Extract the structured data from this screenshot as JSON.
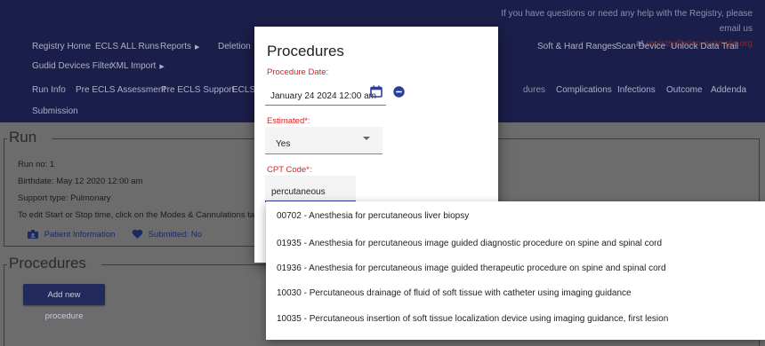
{
  "colors": {
    "nav_bg": "#1b1e4a",
    "overlay_bg": "#6c6c6c",
    "required_label": "#e02020",
    "accent": "#2b3f9a",
    "button_bg": "#222a5c"
  },
  "header": {
    "help_line1": "If you have questions or need any help with the Registry, please email us",
    "help_line2_prefix": "at",
    "help_email": "registry@elso-example.org"
  },
  "nav": {
    "row1": [
      {
        "label": "Registry Home"
      },
      {
        "label": "ECLS ALL Runs"
      },
      {
        "label": "Reports",
        "has_menu": true
      },
      {
        "label": "Deletion"
      },
      {
        "label": "Soft & Hard Ranges"
      },
      {
        "label": "Scan Device"
      },
      {
        "label": "Unlock Data Trail"
      }
    ],
    "row2": [
      {
        "label": "Gudid Devices Filter"
      },
      {
        "label": "XML Import",
        "has_menu": true
      }
    ],
    "row3": [
      {
        "label": "Run Info"
      },
      {
        "label": "Pre ECLS Assessment"
      },
      {
        "label": "Pre ECLS Support"
      },
      {
        "label": "ECLS A"
      },
      {
        "label": "dures"
      },
      {
        "label": "Complications"
      },
      {
        "label": "Infections"
      },
      {
        "label": "Outcome"
      },
      {
        "label": "Addenda"
      }
    ],
    "row4": [
      {
        "label": "Submission"
      }
    ]
  },
  "run": {
    "legend": "Run",
    "run_no": "Run no: 1",
    "birthdate": "Birthdate: May 12 2020 12:00 am",
    "support_type": "Support type: Pulmonary",
    "edit_note": "To edit Start or Stop time, click on the Modes & Cannulations tab abov",
    "patient_info_link": "Patient Information",
    "submitted_status": "Submitted: No"
  },
  "procedures_panel": {
    "legend": "Procedures",
    "add_button": "Add new procedure"
  },
  "modal": {
    "title": "Procedures",
    "procedure_date_label": "Procedure Date:",
    "procedure_date_value": "January 24 2024 12:00 am",
    "estimated_label": "Estimated*:",
    "estimated_value": "Yes",
    "cpt_label": "CPT Code*:",
    "cpt_input_value": "percutaneous"
  },
  "dropdown": {
    "options": [
      {
        "label": "00702 - Anesthesia for percutaneous liver biopsy"
      },
      {
        "label": "01935 - Anesthesia for percutaneous image guided diagnostic procedure on spine and spinal cord"
      },
      {
        "label": "01936 - Anesthesia for percutaneous image guided therapeutic procedure on spine and spinal cord"
      },
      {
        "label": "10030 - Percutaneous drainage of fluid of soft tissue with catheter using imaging guidance"
      },
      {
        "label": "10035 - Percutaneous insertion of soft tissue localization device using imaging guidance, first lesion"
      }
    ]
  },
  "icons": {
    "calendar": "calendar-icon",
    "remove": "minus-circle-icon",
    "patient": "patient-id-icon",
    "submitted": "heart-icon"
  }
}
